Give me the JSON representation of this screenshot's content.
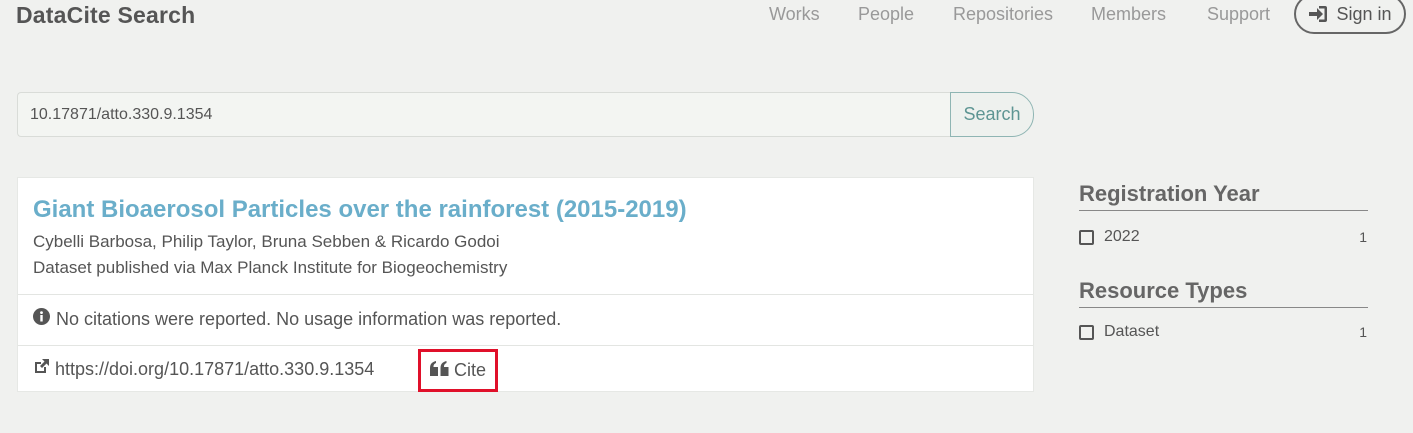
{
  "header": {
    "brand": "DataCite Search",
    "nav": [
      "Works",
      "People",
      "Repositories",
      "Members",
      "Support"
    ],
    "signin_label": "Sign in",
    "signin_icon": "sign-in-icon"
  },
  "search": {
    "value": "10.17871/atto.330.9.1354",
    "button_label": "Search"
  },
  "result": {
    "title": "Giant Bioaerosol Particles over the rainforest (2015-2019)",
    "authors": "Cybelli Barbosa, Philip Taylor, Bruna Sebben & Ricardo Godoi",
    "publisher": "Dataset published via Max Planck Institute for Biogeochemistry",
    "metrics": "No citations were reported. No usage information was reported.",
    "doi_url": "https://doi.org/10.17871/atto.330.9.1354",
    "cite_label": "Cite",
    "title_color": "#6aaeca",
    "cite_highlight_color": "#e0102a"
  },
  "facets": {
    "registration_year": {
      "title": "Registration Year",
      "items": [
        {
          "label": "2022",
          "count": "1"
        }
      ]
    },
    "resource_types": {
      "title": "Resource Types",
      "items": [
        {
          "label": "Dataset",
          "count": "1"
        }
      ]
    }
  }
}
